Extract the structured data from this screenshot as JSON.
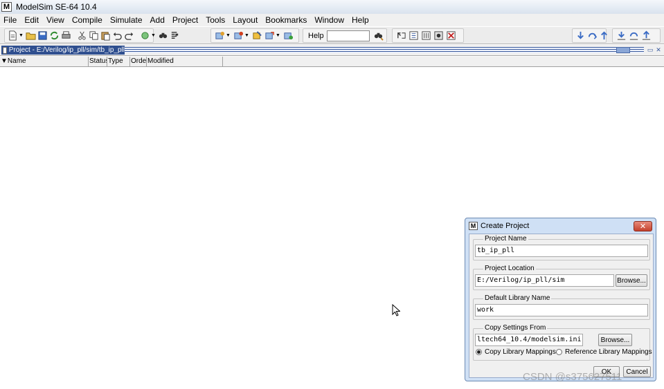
{
  "window": {
    "title": "ModelSim SE-64 10.4",
    "logo": "M"
  },
  "menu": [
    "File",
    "Edit",
    "View",
    "Compile",
    "Simulate",
    "Add",
    "Project",
    "Tools",
    "Layout",
    "Bookmarks",
    "Window",
    "Help"
  ],
  "toolbar": {
    "help_label": "Help",
    "help_value": ""
  },
  "project_panel": {
    "title": "Project - E:/Verilog/ip_pll/sim/tb_ip_pll",
    "columns": [
      "Name",
      "Status",
      "Type",
      "Order",
      "Modified"
    ]
  },
  "dialog": {
    "title": "Create Project",
    "logo": "M",
    "close_glyph": "✕",
    "project_name": {
      "label": "Project Name",
      "value": "tb_ip_pll"
    },
    "project_location": {
      "label": "Project Location",
      "value": "E:/Verilog/ip_pll/sim",
      "browse": "Browse..."
    },
    "default_library": {
      "label": "Default Library Name",
      "value": "work"
    },
    "copy_settings": {
      "label": "Copy Settings From",
      "value": "ltech64_10.4/modelsim.ini",
      "browse": "Browse...",
      "options": [
        "Copy Library Mappings",
        "Reference Library Mappings"
      ],
      "selected": "Copy Library Mappings"
    },
    "ok": "OK",
    "cancel": "Cancel"
  },
  "watermark": "CSDN @s375627511",
  "icons": [
    "new-file-icon",
    "open-folder-icon",
    "save-icon",
    "refresh-icon",
    "print-icon",
    "cut-icon",
    "copy-icon",
    "paste-icon",
    "undo-icon",
    "redo-icon",
    "breakpoint-icon",
    "find-icon",
    "find-replace-icon",
    "compile-icon",
    "compile-all-icon",
    "simulate-icon",
    "break-icon",
    "help-search-icon",
    "restart-icon",
    "run-icon",
    "run-continue-icon",
    "stop-icon",
    "step-icon",
    "step-over-icon",
    "step-out-icon",
    "step-back-icon",
    "step-back-over-icon",
    "step-back-out-icon"
  ]
}
